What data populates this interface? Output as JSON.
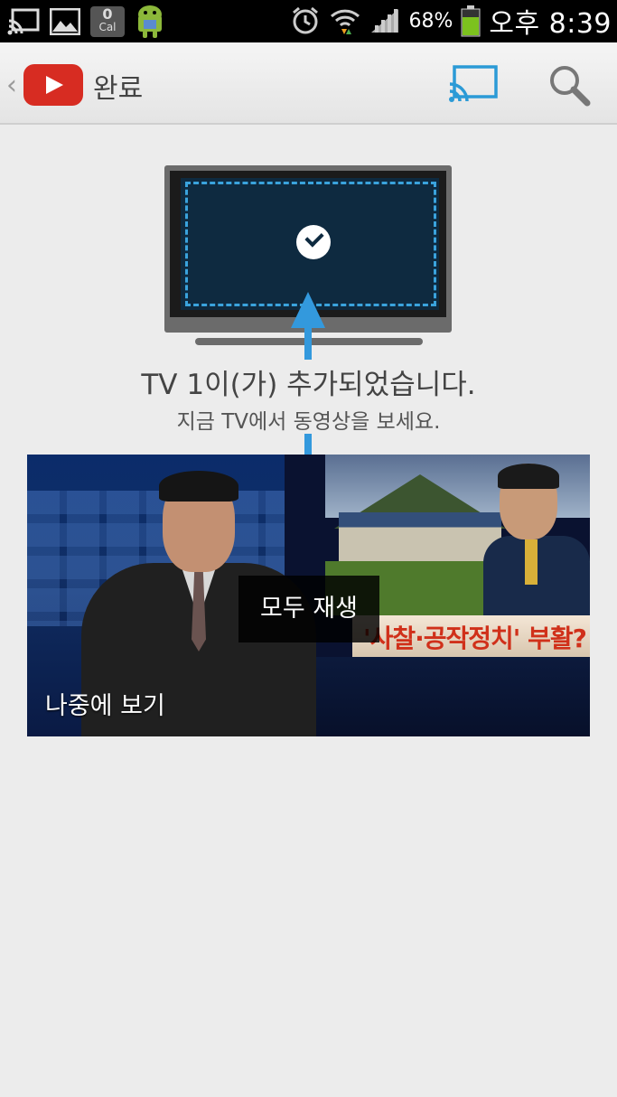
{
  "status_bar": {
    "icons_left": [
      "cast-icon",
      "gallery-icon",
      "calendar-icon",
      "android-icon"
    ],
    "calendar_badge": {
      "number": "0",
      "text": "Cal"
    },
    "icons_right": [
      "alarm-icon",
      "wifi-icon",
      "signal-icon",
      "battery-icon"
    ],
    "battery_percent": "68%",
    "time": "오후 8:39"
  },
  "action_bar": {
    "up_caret": "‹",
    "title": "완료",
    "cast_icon": "cast-icon",
    "search_icon": "search-icon",
    "accent_color": "#3399dd"
  },
  "main": {
    "tv_icon": "tv-icon",
    "check_icon": "check-icon",
    "message_title": "TV 1이(가) 추가되었습니다.",
    "message_subtitle": "지금 TV에서 동영상을 보세요.",
    "video_card": {
      "play_all_label": "모두 재생",
      "playlist_label": "나중에 보기",
      "thumbnail_caption": "'사찰·공작정치' 부활?"
    }
  }
}
